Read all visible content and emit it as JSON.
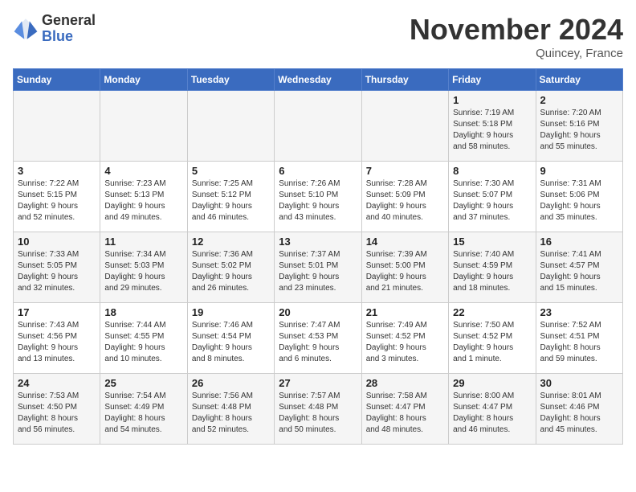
{
  "header": {
    "logo_line1": "General",
    "logo_line2": "Blue",
    "month_title": "November 2024",
    "location": "Quincey, France"
  },
  "weekdays": [
    "Sunday",
    "Monday",
    "Tuesday",
    "Wednesday",
    "Thursday",
    "Friday",
    "Saturday"
  ],
  "weeks": [
    [
      {
        "day": "",
        "info": ""
      },
      {
        "day": "",
        "info": ""
      },
      {
        "day": "",
        "info": ""
      },
      {
        "day": "",
        "info": ""
      },
      {
        "day": "",
        "info": ""
      },
      {
        "day": "1",
        "info": "Sunrise: 7:19 AM\nSunset: 5:18 PM\nDaylight: 9 hours\nand 58 minutes."
      },
      {
        "day": "2",
        "info": "Sunrise: 7:20 AM\nSunset: 5:16 PM\nDaylight: 9 hours\nand 55 minutes."
      }
    ],
    [
      {
        "day": "3",
        "info": "Sunrise: 7:22 AM\nSunset: 5:15 PM\nDaylight: 9 hours\nand 52 minutes."
      },
      {
        "day": "4",
        "info": "Sunrise: 7:23 AM\nSunset: 5:13 PM\nDaylight: 9 hours\nand 49 minutes."
      },
      {
        "day": "5",
        "info": "Sunrise: 7:25 AM\nSunset: 5:12 PM\nDaylight: 9 hours\nand 46 minutes."
      },
      {
        "day": "6",
        "info": "Sunrise: 7:26 AM\nSunset: 5:10 PM\nDaylight: 9 hours\nand 43 minutes."
      },
      {
        "day": "7",
        "info": "Sunrise: 7:28 AM\nSunset: 5:09 PM\nDaylight: 9 hours\nand 40 minutes."
      },
      {
        "day": "8",
        "info": "Sunrise: 7:30 AM\nSunset: 5:07 PM\nDaylight: 9 hours\nand 37 minutes."
      },
      {
        "day": "9",
        "info": "Sunrise: 7:31 AM\nSunset: 5:06 PM\nDaylight: 9 hours\nand 35 minutes."
      }
    ],
    [
      {
        "day": "10",
        "info": "Sunrise: 7:33 AM\nSunset: 5:05 PM\nDaylight: 9 hours\nand 32 minutes."
      },
      {
        "day": "11",
        "info": "Sunrise: 7:34 AM\nSunset: 5:03 PM\nDaylight: 9 hours\nand 29 minutes."
      },
      {
        "day": "12",
        "info": "Sunrise: 7:36 AM\nSunset: 5:02 PM\nDaylight: 9 hours\nand 26 minutes."
      },
      {
        "day": "13",
        "info": "Sunrise: 7:37 AM\nSunset: 5:01 PM\nDaylight: 9 hours\nand 23 minutes."
      },
      {
        "day": "14",
        "info": "Sunrise: 7:39 AM\nSunset: 5:00 PM\nDaylight: 9 hours\nand 21 minutes."
      },
      {
        "day": "15",
        "info": "Sunrise: 7:40 AM\nSunset: 4:59 PM\nDaylight: 9 hours\nand 18 minutes."
      },
      {
        "day": "16",
        "info": "Sunrise: 7:41 AM\nSunset: 4:57 PM\nDaylight: 9 hours\nand 15 minutes."
      }
    ],
    [
      {
        "day": "17",
        "info": "Sunrise: 7:43 AM\nSunset: 4:56 PM\nDaylight: 9 hours\nand 13 minutes."
      },
      {
        "day": "18",
        "info": "Sunrise: 7:44 AM\nSunset: 4:55 PM\nDaylight: 9 hours\nand 10 minutes."
      },
      {
        "day": "19",
        "info": "Sunrise: 7:46 AM\nSunset: 4:54 PM\nDaylight: 9 hours\nand 8 minutes."
      },
      {
        "day": "20",
        "info": "Sunrise: 7:47 AM\nSunset: 4:53 PM\nDaylight: 9 hours\nand 6 minutes."
      },
      {
        "day": "21",
        "info": "Sunrise: 7:49 AM\nSunset: 4:52 PM\nDaylight: 9 hours\nand 3 minutes."
      },
      {
        "day": "22",
        "info": "Sunrise: 7:50 AM\nSunset: 4:52 PM\nDaylight: 9 hours\nand 1 minute."
      },
      {
        "day": "23",
        "info": "Sunrise: 7:52 AM\nSunset: 4:51 PM\nDaylight: 8 hours\nand 59 minutes."
      }
    ],
    [
      {
        "day": "24",
        "info": "Sunrise: 7:53 AM\nSunset: 4:50 PM\nDaylight: 8 hours\nand 56 minutes."
      },
      {
        "day": "25",
        "info": "Sunrise: 7:54 AM\nSunset: 4:49 PM\nDaylight: 8 hours\nand 54 minutes."
      },
      {
        "day": "26",
        "info": "Sunrise: 7:56 AM\nSunset: 4:48 PM\nDaylight: 8 hours\nand 52 minutes."
      },
      {
        "day": "27",
        "info": "Sunrise: 7:57 AM\nSunset: 4:48 PM\nDaylight: 8 hours\nand 50 minutes."
      },
      {
        "day": "28",
        "info": "Sunrise: 7:58 AM\nSunset: 4:47 PM\nDaylight: 8 hours\nand 48 minutes."
      },
      {
        "day": "29",
        "info": "Sunrise: 8:00 AM\nSunset: 4:47 PM\nDaylight: 8 hours\nand 46 minutes."
      },
      {
        "day": "30",
        "info": "Sunrise: 8:01 AM\nSunset: 4:46 PM\nDaylight: 8 hours\nand 45 minutes."
      }
    ]
  ]
}
